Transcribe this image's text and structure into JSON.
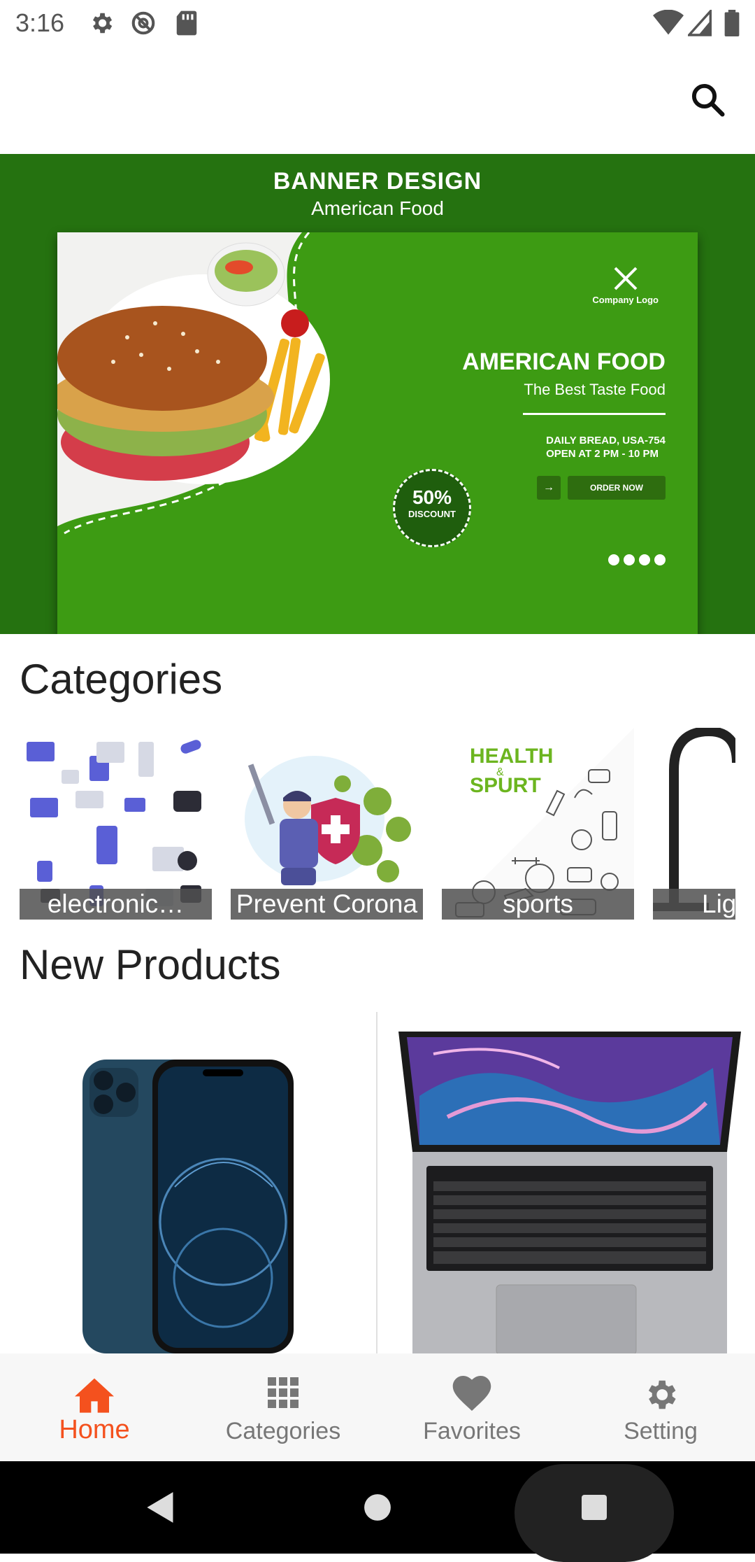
{
  "status_bar": {
    "time": "3:16",
    "left_icons": [
      "settings-icon",
      "at-sign-icon",
      "sd-card-icon"
    ],
    "right_icons": [
      "wifi-icon",
      "signal-icon",
      "battery-icon"
    ]
  },
  "app_bar": {
    "search_icon": "search-icon"
  },
  "banner": {
    "title": "BANNER DESIGN",
    "subtitle": "American Food",
    "card": {
      "company_logo": "Company Logo",
      "headline": "AMERICAN FOOD",
      "tagline": "The Best Taste Food",
      "address_line1": "DAILY BREAD, USA-754",
      "address_line2": "OPEN AT 2 PM - 10 PM",
      "order_button": "ORDER NOW",
      "discount_pct": "50%",
      "discount_word": "DISCOUNT"
    }
  },
  "categories": {
    "title": "Categories",
    "items": [
      {
        "label": "electronic…",
        "image": "electronics-isometric-icons"
      },
      {
        "label": "Prevent Corona",
        "image": "man-with-shield-fighting-virus"
      },
      {
        "label": "sports",
        "image": "health-sport-doodles",
        "image_text_1": "HEALTH",
        "image_text_2": "&",
        "image_text_3": "SPURT"
      },
      {
        "label": "Lig",
        "image": "lamp"
      }
    ]
  },
  "new_products": {
    "title": "New Products",
    "items": [
      {
        "image": "iphone-pacific-blue"
      },
      {
        "image": "macbook-pro-space-gray"
      }
    ]
  },
  "bottom_nav": {
    "items": [
      {
        "label": "Home",
        "icon": "home-icon",
        "active": true
      },
      {
        "label": "Categories",
        "icon": "grid-icon",
        "active": false
      },
      {
        "label": "Favorites",
        "icon": "heart-icon",
        "active": false
      },
      {
        "label": "Setting",
        "icon": "gear-icon",
        "active": false
      }
    ]
  },
  "colors": {
    "accent": "#f4511e",
    "banner_green": "#257210",
    "card_green": "#3d9b13"
  }
}
